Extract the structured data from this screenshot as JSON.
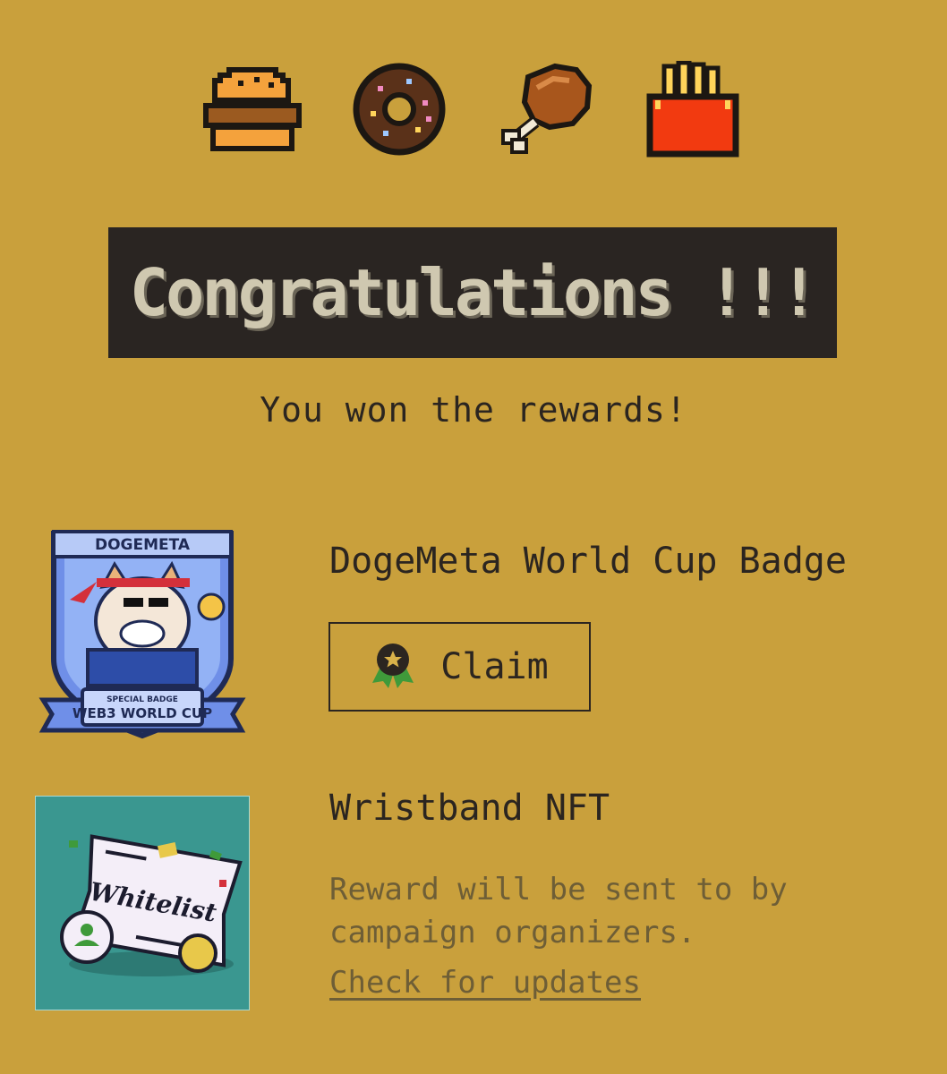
{
  "header": {
    "icons": [
      "burger-icon",
      "donut-icon",
      "chicken-leg-icon",
      "fries-icon"
    ],
    "title": "Congratulations !!!",
    "subtitle": "You won the rewards!"
  },
  "rewards": [
    {
      "name": "DogeMeta World Cup Badge",
      "image_text_top": "DOGEMETA",
      "image_text_ribbon_small": "SPECIAL BADGE",
      "image_text_ribbon": "WEB3 WORLD CUP",
      "action_label": "Claim",
      "action_icon": "award-icon"
    },
    {
      "name": "Wristband NFT",
      "image_text": "Whitelist",
      "note": "Reward will be sent to by campaign organizers.",
      "link_label": "Check for updates"
    }
  ],
  "colors": {
    "background": "#c9a03c",
    "banner": "#2a2522",
    "text": "#2b2520",
    "muted_text": "#6e5e36"
  }
}
